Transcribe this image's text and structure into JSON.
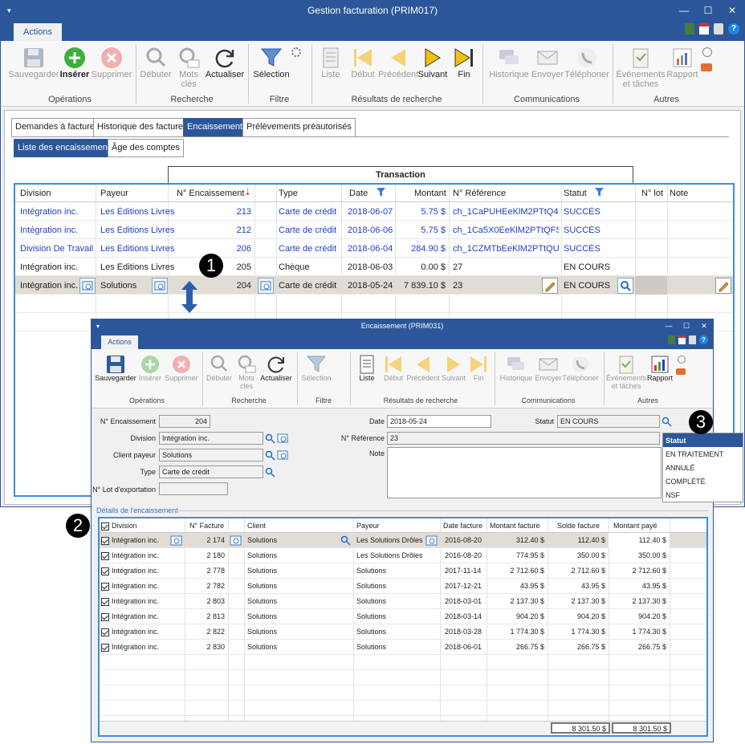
{
  "main": {
    "title": "Gestion facturation (PRIM017)",
    "tab": "Actions",
    "ribbon": {
      "save": "Sauvegarder",
      "insert": "Insérer",
      "delete": "Supprimer",
      "start": "Débuter",
      "keywords": "Mots clés",
      "refresh": "Actualiser",
      "selection": "Sélection",
      "list": "Liste",
      "first": "Début",
      "prev": "Précédent",
      "next": "Suivant",
      "last": "Fin",
      "history": "Historique",
      "send": "Envoyer",
      "phone": "Téléphoner",
      "events": "Événements et tâches",
      "report": "Rapport",
      "groups": {
        "ops": "Opérations",
        "search": "Recherche",
        "filter": "Filtre",
        "results": "Résultats de recherche",
        "comms": "Communications",
        "other": "Autres"
      }
    },
    "tabs": [
      "Demandes à facturer",
      "Historique des factures",
      "Encaissements",
      "Prélèvements préautorisés"
    ],
    "subtabs": [
      "Liste des encaissements",
      "Âge des comptes"
    ],
    "group_header": "Transaction",
    "columns": [
      "Division",
      "Payeur",
      "N° Encaissement",
      "Type",
      "Date",
      "Montant",
      "N° Référence",
      "Statut",
      "N° lot",
      "Note"
    ],
    "rows": [
      [
        "Intégration inc.",
        "Les Éditions Livres",
        "213",
        "Carte de crédit",
        "2018-06-07",
        "5.75 $",
        "ch_1CaPUHEeKlM2PTtQ4v...",
        "SUCCÈS"
      ],
      [
        "Intégration inc.",
        "Les Éditions Livres",
        "212",
        "Carte de crédit",
        "2018-06-06",
        "5.75 $",
        "ch_1Ca5X0EeKlM2PTtQFS...",
        "SUCCÈS"
      ],
      [
        "Division De Travail",
        "Les Éditions Livres",
        "206",
        "Carte de crédit",
        "2018-06-04",
        "284.90 $",
        "ch_1CZMTbEeKlM2PTtQUV...",
        "SUCCÈS"
      ],
      [
        "Intégration inc.",
        "Les Éditions Livres",
        "205",
        "Chèque",
        "2018-06-03",
        "0.00 $",
        "27",
        "EN COURS"
      ],
      [
        "Intégration inc.",
        "Solutions",
        "204",
        "Carte de crédit",
        "2018-05-24",
        "7 839.10 $",
        "23",
        "EN COURS"
      ]
    ]
  },
  "callouts": [
    "1",
    "2",
    "3"
  ],
  "detail": {
    "title": "Encaissement (PRIM031)",
    "tab": "Actions",
    "ribbon": {
      "save": "Sauvegarder",
      "insert": "Insérer",
      "delete": "Supprimer",
      "start": "Débuter",
      "keywords": "Mots clés",
      "refresh": "Actualiser",
      "selection": "Sélection",
      "list": "Liste",
      "first": "Début",
      "prev": "Précédent",
      "next": "Suivant",
      "last": "Fin",
      "history": "Historique",
      "send": "Envoyer",
      "phone": "Téléphoner",
      "events": "Événements et tâches",
      "report": "Rapport",
      "groups": {
        "ops": "Opérations",
        "search": "Recherche",
        "filter": "Filtre",
        "results": "Résultats de recherche",
        "comms": "Communications",
        "other": "Autres"
      }
    },
    "form": {
      "num_label": "N° Encaissement",
      "num": "204",
      "division_label": "Division",
      "division": "Intégration inc.",
      "client_label": "Client payeur",
      "client": "Solutions",
      "type_label": "Type",
      "type": "Carte de crédit",
      "lot_label": "N° Lot d'exportation",
      "lot": "",
      "date_label": "Date",
      "date": "2018-05-24",
      "ref_label": "N° Référence",
      "ref": "23",
      "note_label": "Note",
      "note": "",
      "status_label": "Statut",
      "status": "EN COURS"
    },
    "status_options": [
      "Statut",
      "EN TRAITEMENT",
      "ANNULÉ",
      "COMPLÉTÉ",
      "NSF"
    ],
    "section": "Détails de l'encaissement",
    "columns": [
      "Division",
      "N° Facture",
      "Client",
      "Payeur",
      "Date facture",
      "Montant facture",
      "Solde facture",
      "Montant payé"
    ],
    "rows": [
      [
        "Intégration inc.",
        "2 174",
        "Solutions",
        "Les Solutions Drôles",
        "2016-08-20",
        "312.40 $",
        "112.40 $",
        "112.40 $"
      ],
      [
        "Intégration inc.",
        "2 180",
        "Solutions",
        "Les Solutions Drôles",
        "2016-08-20",
        "774.95 $",
        "350.00 $",
        "350.00 $"
      ],
      [
        "Intégration inc.",
        "2 778",
        "Solutions",
        "Solutions",
        "2017-11-14",
        "2 712.60 $",
        "2 712.60 $",
        "2 712.60 $"
      ],
      [
        "Intégration inc.",
        "2 782",
        "Solutions",
        "Solutions",
        "2017-12-21",
        "43.95 $",
        "43.95 $",
        "43.95 $"
      ],
      [
        "Intégration inc.",
        "2 803",
        "Solutions",
        "Solutions",
        "2018-03-01",
        "2 137.30 $",
        "2 137.30 $",
        "2 137.30 $"
      ],
      [
        "Intégration inc.",
        "2 813",
        "Solutions",
        "Solutions",
        "2018-03-14",
        "904.20 $",
        "904.20 $",
        "904.20 $"
      ],
      [
        "Intégration inc.",
        "2 822",
        "Solutions",
        "Solutions",
        "2018-03-28",
        "1 774.30 $",
        "1 774.30 $",
        "1 774.30 $"
      ],
      [
        "Intégration inc.",
        "2 830",
        "Solutions",
        "Solutions",
        "2018-06-01",
        "266.75 $",
        "266.75 $",
        "266.75 $"
      ]
    ],
    "totals": [
      "8 301.50 $",
      "8 301.50 $"
    ]
  },
  "colors": {
    "accent": "#2b579a",
    "grid_border": "#3c8fdd",
    "link": "#1f3fbf",
    "selected_row": "#e1dcd5"
  }
}
